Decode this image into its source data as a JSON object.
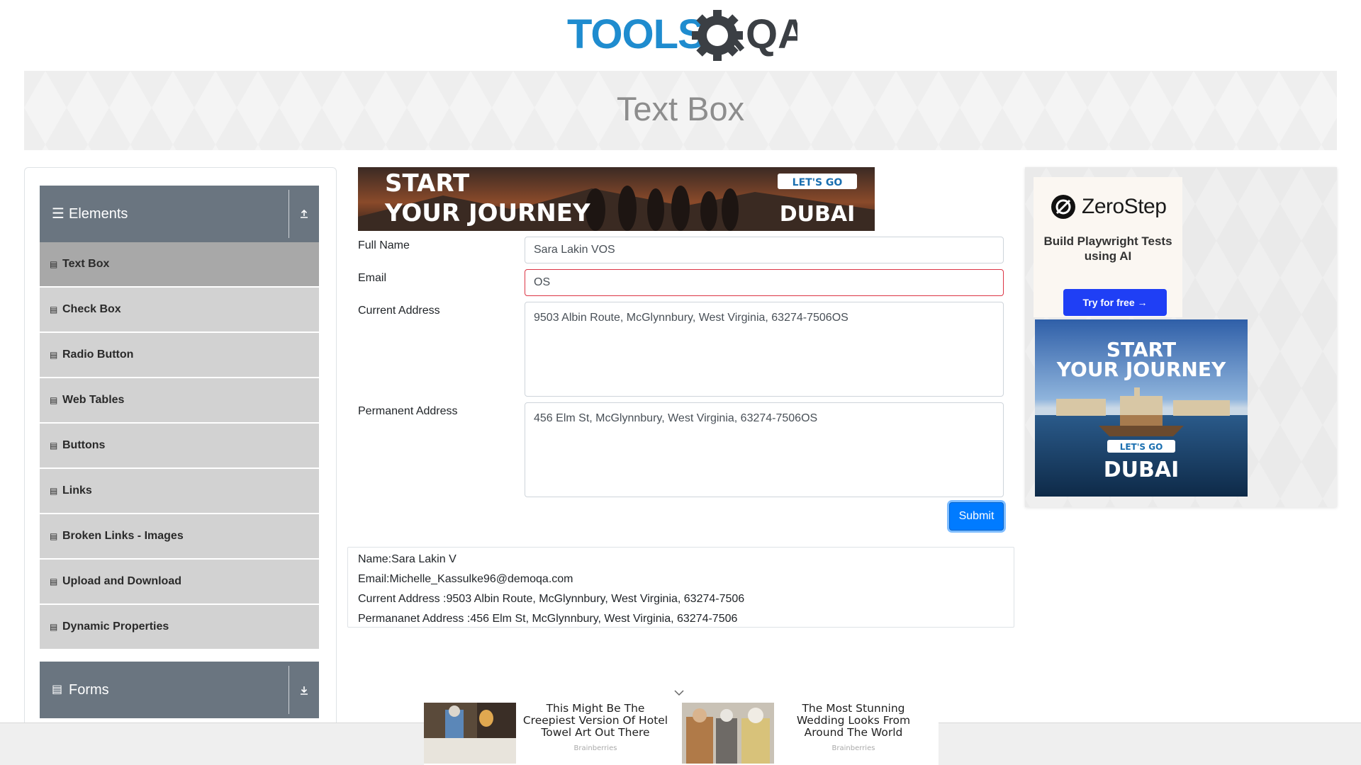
{
  "header": {
    "logo_text_tools": "TOOLS",
    "logo_text_qa": "QA"
  },
  "banner": {
    "title": "Text Box"
  },
  "sidebar": {
    "elements_group": {
      "label": "Elements",
      "icon": "hamburger-icon",
      "toggle_icon": "collapse-up-icon"
    },
    "items": [
      {
        "label": "Text Box",
        "active": true
      },
      {
        "label": "Check Box"
      },
      {
        "label": "Radio Button"
      },
      {
        "label": "Web Tables"
      },
      {
        "label": "Buttons"
      },
      {
        "label": "Links"
      },
      {
        "label": "Broken Links - Images"
      },
      {
        "label": "Upload and Download"
      },
      {
        "label": "Dynamic Properties"
      }
    ],
    "forms_group": {
      "label": "Forms",
      "icon": "document-icon",
      "toggle_icon": "expand-down-icon"
    }
  },
  "top_ad": {
    "headline_line1": "START",
    "headline_line2": "YOUR JOURNEY",
    "cta": "LET'S GO",
    "brand": "DUBAI"
  },
  "form": {
    "full_name": {
      "label": "Full Name",
      "value": "Sara Lakin VOS"
    },
    "email": {
      "label": "Email",
      "value": "OS",
      "invalid": true
    },
    "current_address": {
      "label": "Current Address",
      "value": "9503 Albin Route, McGlynnbury, West Virginia, 63274-7506OS"
    },
    "permanent_address": {
      "label": "Permanent Address",
      "value": "456 Elm St, McGlynnbury, West Virginia, 63274-7506OS"
    },
    "submit_label": "Submit"
  },
  "output": {
    "name": "Name:Sara Lakin V",
    "email": "Email:Michelle_Kassulke96@demoqa.com",
    "current_address": "Current Address :9503 Albin Route, McGlynnbury, West Virginia, 63274-7506",
    "permanent_address": "Permananet Address :456 Elm St, McGlynnbury, West Virginia, 63274-7506"
  },
  "right_ad": {
    "brand": "ZeroStep",
    "tagline": "Build Playwright Tests using AI",
    "cta": "Try for free →",
    "dubai_line1": "START",
    "dubai_line2": "YOUR JOURNEY",
    "dubai_cta": "LET'S GO",
    "dubai_brand": "DUBAI"
  },
  "native_ads": [
    {
      "title": "This Might Be The Creepiest Version Of Hotel Towel Art Out There",
      "source": "Brainberries"
    },
    {
      "title": "The Most Stunning Wedding Looks From Around The World",
      "source": "Brainberries"
    }
  ],
  "colors": {
    "sidebar_header": "#6a7580",
    "menu_item": "#d2d2d2",
    "menu_item_active": "#a8a8a8",
    "primary": "#007bff",
    "error": "#dc3545",
    "zerostep_button": "#1f3ff5"
  }
}
